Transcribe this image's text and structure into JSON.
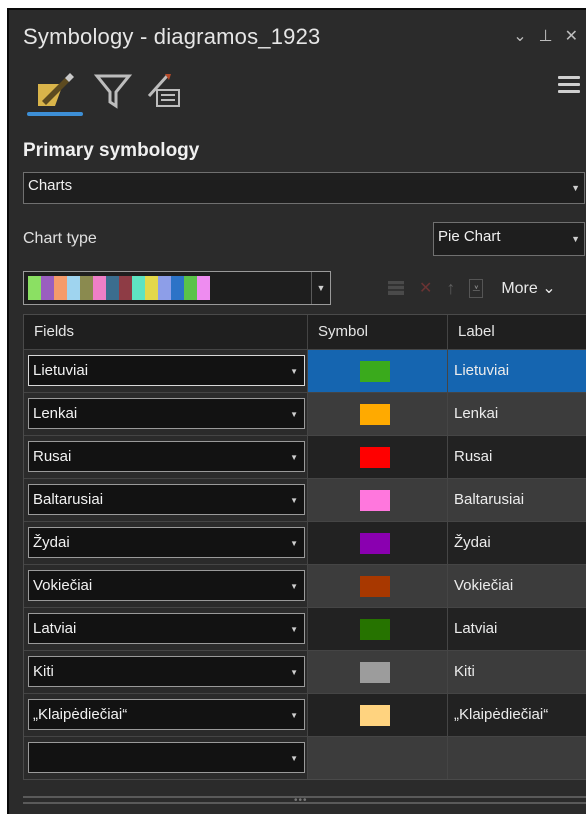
{
  "window": {
    "title": "Symbology - diagramos_1923",
    "controls": [
      "chevron-down-icon",
      "pin-icon",
      "close-icon"
    ]
  },
  "tabs": [
    "paintbrush-icon",
    "filter-icon",
    "label-list-icon"
  ],
  "primary": {
    "heading": "Primary symbology",
    "selected": "Charts"
  },
  "chart_type": {
    "label": "Chart type",
    "selected": "Pie Chart"
  },
  "color_ramp": [
    "#8be063",
    "#9a5fbf",
    "#f59b6b",
    "#9fd4ef",
    "#8a8a4f",
    "#ee7fc7",
    "#3b6d8e",
    "#8e3c45",
    "#5fe3c1",
    "#e4d84a",
    "#8d9ee8",
    "#2c73c7",
    "#5ac24a",
    "#ee8cf0"
  ],
  "toolbar": {
    "more_label": "More"
  },
  "table": {
    "headers": [
      "Fields",
      "Symbol",
      "Label"
    ],
    "rows": [
      {
        "field": "Lietuviai",
        "color": "#3aaa1c",
        "label": "Lietuviai"
      },
      {
        "field": "Lenkai",
        "color": "#ffaa00",
        "label": "Lenkai"
      },
      {
        "field": "Rusai",
        "color": "#ff0000",
        "label": "Rusai"
      },
      {
        "field": "Baltarusiai",
        "color": "#ff77dd",
        "label": "Baltarusiai"
      },
      {
        "field": "Žydai",
        "color": "#8a00b0",
        "label": "Žydai"
      },
      {
        "field": "Vokiečiai",
        "color": "#a83800",
        "label": "Vokiečiai"
      },
      {
        "field": "Latviai",
        "color": "#267300",
        "label": "Latviai"
      },
      {
        "field": "Kiti",
        "color": "#9c9c9c",
        "label": "Kiti"
      },
      {
        "field": "„Klaipėdiečiai“",
        "color": "#ffd37f",
        "label": "„Klaipėdiečiai“"
      },
      {
        "field": "",
        "color": "",
        "label": ""
      }
    ]
  }
}
